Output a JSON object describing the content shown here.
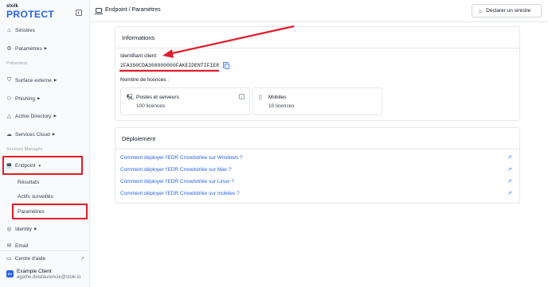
{
  "brand": {
    "small": "stoïk",
    "big": "PROTECT"
  },
  "sidebar": {
    "items": [
      {
        "label": "Sinistres",
        "icon": "fire-icon",
        "caret": false
      },
      {
        "label": "Paramètres",
        "icon": "gear-icon",
        "caret": true
      }
    ],
    "section_prevention": "Prévention",
    "prevention_items": [
      {
        "label": "Surface externe",
        "icon": "shield-icon"
      },
      {
        "label": "Phishing",
        "icon": "phishing-icon"
      },
      {
        "label": "Active Directory",
        "icon": "network-icon"
      },
      {
        "label": "Services Cloud",
        "icon": "cloud-icon"
      }
    ],
    "section_managed": "Services Managés",
    "endpoint": {
      "label": "Endpoint",
      "icon": "laptop-icon",
      "caret": "▼"
    },
    "endpoint_subitems": [
      "Résultats",
      "Actifs surveillés",
      "Paramètres"
    ],
    "identity": {
      "label": "Identity",
      "icon": "fingerprint-icon"
    },
    "partial_item": "Email",
    "help": "Centre d'aide",
    "user": {
      "initials": "EX",
      "name": "Example Client",
      "email": "agathe.delalaurencie@stoik.io"
    }
  },
  "header": {
    "breadcrumb": "Endpoint / Paramètres",
    "report_button": "Déclarer un sinistre"
  },
  "informations": {
    "title": "Informations",
    "client_id_label": "Identifiant client",
    "client_id": "2FA390CDA300000000FAKEIDENTIFIER",
    "licences_label": "Nombre de licences :",
    "licences": [
      {
        "title": "Postes et serveurs",
        "count": "100 licences",
        "icon": "computer-icon"
      },
      {
        "title": "Mobiles",
        "count": "10 licences",
        "icon": "mobile-icon"
      }
    ]
  },
  "deploiement": {
    "title": "Déploiement",
    "links": [
      "Comment déployer l'EDR Crowdstrike sur Windows ?",
      "Comment déployer l'EDR Crowdstrike sur Mac ?",
      "Comment déployer l'EDR Crowdstrike sur Linux ?",
      "Comment déployer l'EDR Crowdstrike sur mobiles ?"
    ]
  },
  "colors": {
    "brand": "#2563eb",
    "annotation": "#e11d2b",
    "link": "#2563eb"
  }
}
